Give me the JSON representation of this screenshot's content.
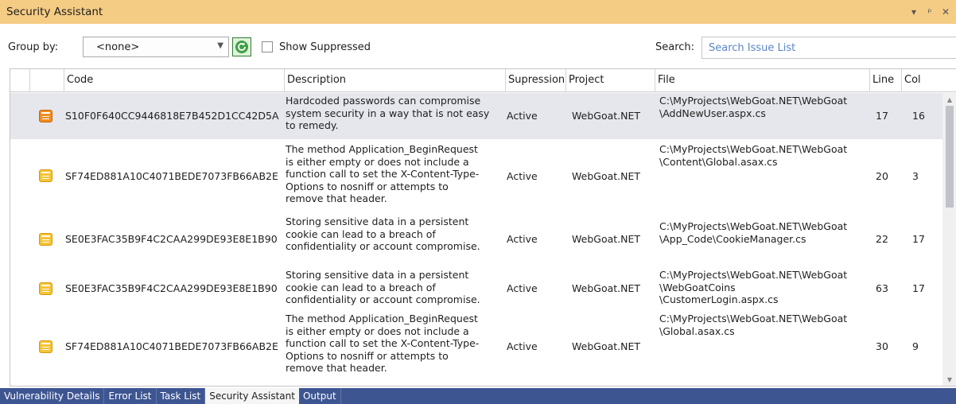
{
  "window": {
    "title": "Security Assistant",
    "controls": [
      "▾",
      "ᵖ",
      "✕"
    ]
  },
  "toolbar": {
    "group_by_label": "Group by:",
    "group_by_value": "<none>",
    "show_suppressed_label": "Show Suppressed",
    "show_suppressed_checked": false,
    "search_label": "Search:",
    "search_placeholder": "Search Issue List",
    "refresh_icon": "refresh-icon"
  },
  "grid": {
    "columns": [
      "Code",
      "Description",
      "Supression",
      "Project",
      "File",
      "Line",
      "Col"
    ],
    "rows": [
      {
        "selected": true,
        "code": "S10F0F640CC9446818E7B452D1CC42D5A",
        "description": [
          "Hardcoded passwords can compromise",
          "system security in a way that is not easy",
          "to remedy."
        ],
        "supression": "Active",
        "project": "WebGoat.NET",
        "file": [
          "C:\\MyProjects\\WebGoat.NET\\WebGoat",
          "\\AddNewUser.aspx.cs"
        ],
        "line": "17",
        "col": "16"
      },
      {
        "selected": false,
        "code": "SF74ED881A10C4071BEDE7073FB66AB2E",
        "description": [
          "The method Application_BeginRequest",
          "is either empty or does not include a",
          "function call to set the X-Content-Type-",
          "Options to nosniff or attempts to",
          "remove that header."
        ],
        "supression": "Active",
        "project": "WebGoat.NET",
        "file": [
          "C:\\MyProjects\\WebGoat.NET\\WebGoat",
          "\\Content\\Global.asax.cs"
        ],
        "line": "20",
        "col": "3"
      },
      {
        "selected": false,
        "code": "SE0E3FAC35B9F4C2CAA299DE93E8E1B90",
        "description": [
          "Storing sensitive data in a persistent",
          "cookie can lead to a breach of",
          "confidentiality or account compromise."
        ],
        "supression": "Active",
        "project": "WebGoat.NET",
        "file": [
          "C:\\MyProjects\\WebGoat.NET\\WebGoat",
          "\\App_Code\\CookieManager.cs"
        ],
        "line": "22",
        "col": "17"
      },
      {
        "selected": false,
        "code": "SE0E3FAC35B9F4C2CAA299DE93E8E1B90",
        "description": [
          "Storing sensitive data in a persistent",
          "cookie can lead to a breach of",
          "confidentiality or account compromise."
        ],
        "supression": "Active",
        "project": "WebGoat.NET",
        "file": [
          "C:\\MyProjects\\WebGoat.NET\\WebGoat",
          "\\WebGoatCoins",
          "\\CustomerLogin.aspx.cs"
        ],
        "line": "63",
        "col": "17"
      },
      {
        "selected": false,
        "code": "SF74ED881A10C4071BEDE7073FB66AB2E",
        "description": [
          "The method Application_BeginRequest",
          "is either empty or does not include a",
          "function call to set the X-Content-Type-",
          "Options to nosniff or attempts to",
          "remove that header."
        ],
        "supression": "Active",
        "project": "WebGoat.NET",
        "file": [
          "C:\\MyProjects\\WebGoat.NET\\WebGoat",
          "\\Global.asax.cs"
        ],
        "line": "30",
        "col": "9"
      }
    ]
  },
  "tabs": [
    {
      "label": "Vulnerability Details",
      "active": false
    },
    {
      "label": "Error List",
      "active": false
    },
    {
      "label": "Task List",
      "active": false
    },
    {
      "label": "Security Assistant",
      "active": true
    },
    {
      "label": "Output",
      "active": false
    }
  ],
  "colors": {
    "title_bar": "#f5cc84",
    "tab_strip": "#3d5591",
    "selected_row": "#e6e7ed",
    "icon_high": "#f38b1c",
    "icon_medium": "#f7c331"
  }
}
